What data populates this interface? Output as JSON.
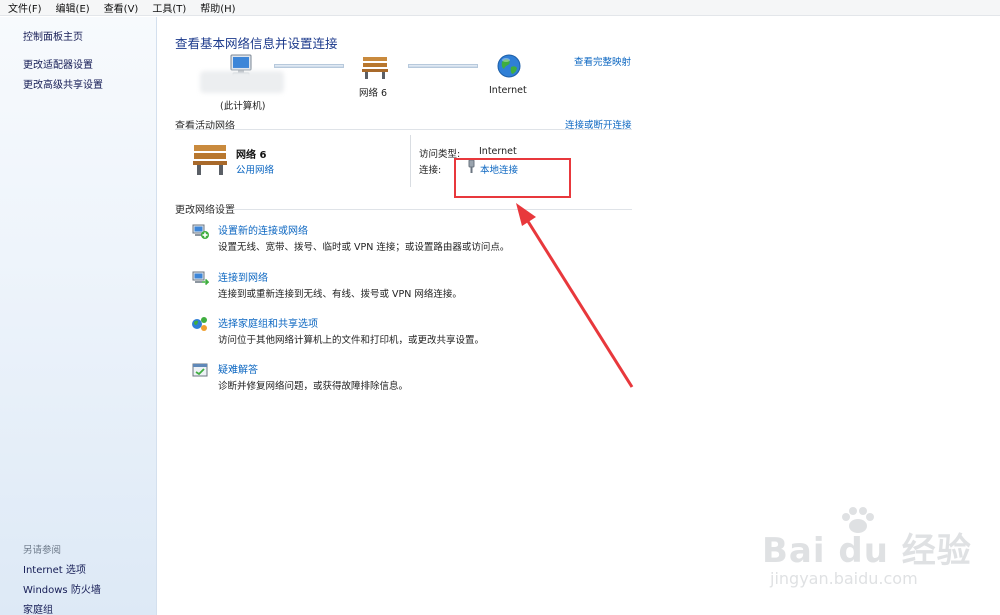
{
  "menu": [
    "文件(F)",
    "编辑(E)",
    "查看(V)",
    "工具(T)",
    "帮助(H)"
  ],
  "sidebar": {
    "links": [
      "控制面板主页",
      "更改适配器设置",
      "更改高级共享设置"
    ],
    "see_also_title": "另请参阅",
    "see_also": [
      "Internet 选项",
      "Windows 防火墙",
      "家庭组"
    ]
  },
  "main": {
    "title": "查看基本网络信息并设置连接",
    "full_map_link": "查看完整映射",
    "diagram": {
      "computer_label": "(此计算机)",
      "network_label": "网络  6",
      "internet_label": "Internet"
    },
    "active": {
      "heading": "查看活动网络",
      "connect_link": "连接或断开连接",
      "network_name": "网络  6",
      "network_type": "公用网络",
      "access_type_label": "访问类型:",
      "access_type_value": "Internet",
      "connection_label": "连接:",
      "connection_value": "本地连接"
    },
    "change": {
      "heading": "更改网络设置",
      "tasks": [
        {
          "icon": "new-connection-icon",
          "link": "设置新的连接或网络",
          "desc": "设置无线、宽带、拨号、临时或 VPN 连接；或设置路由器或访问点。"
        },
        {
          "icon": "connect-network-icon",
          "link": "连接到网络",
          "desc": "连接到或重新连接到无线、有线、拨号或 VPN 网络连接。"
        },
        {
          "icon": "homegroup-icon",
          "link": "选择家庭组和共享选项",
          "desc": "访问位于其他网络计算机上的文件和打印机，或更改共享设置。"
        },
        {
          "icon": "troubleshoot-icon",
          "link": "疑难解答",
          "desc": "诊断并修复网络问题，或获得故障排除信息。"
        }
      ]
    }
  },
  "watermark": {
    "brand": "Bai du 经验",
    "url": "jingyan.baidu.com"
  },
  "colors": {
    "link": "#0b66c1",
    "title": "#1c3a8c",
    "annotation": "#e8383c"
  }
}
